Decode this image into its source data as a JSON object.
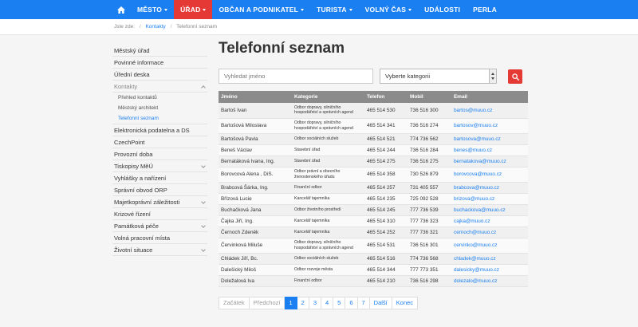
{
  "nav": {
    "home_icon": "home-icon",
    "items": [
      {
        "label": "MĚSTO",
        "dropdown": true
      },
      {
        "label": "ÚŘAD",
        "dropdown": true,
        "active": true
      },
      {
        "label": "OBČAN A PODNIKATEL",
        "dropdown": true
      },
      {
        "label": "TURISTA",
        "dropdown": true
      },
      {
        "label": "VOLNÝ ČAS",
        "dropdown": true
      },
      {
        "label": "UDÁLOSTI",
        "dropdown": false
      },
      {
        "label": "PERLA",
        "dropdown": false
      }
    ],
    "active_color": "#e53935",
    "bar_color": "#1a7ff0"
  },
  "breadcrumb": {
    "prefix": "Jste zde:",
    "items": [
      "Kontakty",
      "Telefonní seznam"
    ]
  },
  "sidebar": {
    "items": [
      {
        "label": "Městský úřad"
      },
      {
        "label": "Povinné informace"
      },
      {
        "label": "Úřední deska"
      },
      {
        "label": "Kontakty",
        "expanded": true,
        "chevron": "chevron-up-icon"
      },
      {
        "label": "Elektronická podatelna a DS"
      },
      {
        "label": "CzechPoint"
      },
      {
        "label": "Provozní doba"
      },
      {
        "label": "Tiskopisy MěÚ",
        "chevron": "chevron-down-icon"
      },
      {
        "label": "Vyhlášky a nařízení"
      },
      {
        "label": "Správní obvod ORP"
      },
      {
        "label": "Majetkoprávní záležitosti",
        "chevron": "chevron-down-icon"
      },
      {
        "label": "Krizové řízení"
      },
      {
        "label": "Památková péče",
        "chevron": "chevron-down-icon"
      },
      {
        "label": "Volná pracovní místa"
      },
      {
        "label": "Životní situace",
        "chevron": "chevron-down-icon"
      }
    ],
    "subitems": [
      {
        "label": "Přehled kontaktů"
      },
      {
        "label": "Městský architekt"
      },
      {
        "label": "Telefonní seznam",
        "current": true
      }
    ]
  },
  "main": {
    "title": "Telefonní seznam",
    "search_placeholder": "Vyhledat jméno",
    "category_select": "Vyberte kategorii",
    "search_button_icon": "search-icon"
  },
  "table": {
    "headers": [
      "Jméno",
      "Kategorie",
      "Telefon",
      "Mobil",
      "Email"
    ],
    "rows": [
      {
        "name": "Bartoš Ivan",
        "category": "Odbor dopravy, silničního hospodářství a správních agend",
        "phone": "465 514 530",
        "mobile": "736 516 300",
        "email": "bartos@muuo.cz"
      },
      {
        "name": "Bartošová Miloslava",
        "category": "Odbor dopravy, silničního hospodářství a správních agend",
        "phone": "465 514 341",
        "mobile": "736 516 274",
        "email": "bartosov@muuo.cz"
      },
      {
        "name": "Bartošová Pavla",
        "category": "Odbor sociálních služeb",
        "phone": "465 514 521",
        "mobile": "774 736 562",
        "email": "bartosova@muuo.cz"
      },
      {
        "name": "Beneš Václav",
        "category": "Stavební úřad",
        "phone": "465 514 244",
        "mobile": "736 516 284",
        "email": "benes@muuo.cz"
      },
      {
        "name": "Bernatáková Ivana, Ing.",
        "category": "Stavební úřad",
        "phone": "465 514 275",
        "mobile": "736 516 275",
        "email": "bernatakova@muuo.cz"
      },
      {
        "name": "Borovcová Alena , DiS.",
        "category": "Odbor právní a obecního živnostenského úřadu",
        "phone": "465 514 358",
        "mobile": "730 526 879",
        "email": "borovcova@muuo.cz"
      },
      {
        "name": "Brabcová Šárka, Ing.",
        "category": "Finanční odbor",
        "phone": "465 514 257",
        "mobile": "731 405 557",
        "email": "brabcova@muuo.cz"
      },
      {
        "name": "Břízová Lucie",
        "category": "Kancelář tajemníka",
        "phone": "465 514 235",
        "mobile": "725 092 528",
        "email": "brizova@muuo.cz"
      },
      {
        "name": "Buchačková Jana",
        "category": "Odbor životního prostředí",
        "phone": "465 514 245",
        "mobile": "777 736 539",
        "email": "buchackova@muuo.cz"
      },
      {
        "name": "Čajka Jiří, Ing.",
        "category": "Kancelář tajemníka",
        "phone": "465 514 310",
        "mobile": "777 736 323",
        "email": "cajka@muuo.cz"
      },
      {
        "name": "Černoch Zdeněk",
        "category": "Kancelář tajemníka",
        "phone": "465 514 252",
        "mobile": "777 736 321",
        "email": "cernoch@muuo.cz"
      },
      {
        "name": "Červinková Miluše",
        "category": "Odbor dopravy, silničního hospodářství a správních agend",
        "phone": "465 514 531",
        "mobile": "736 516 301",
        "email": "cervinko@muuo.cz"
      },
      {
        "name": "Chládek Jiří, Bc.",
        "category": "Odbor sociálních služeb",
        "phone": "465 514 516",
        "mobile": "774 736 568",
        "email": "chladek@muuo.cz"
      },
      {
        "name": "Dalešický Miloš",
        "category": "Odbor rozvoje města",
        "phone": "465 514 344",
        "mobile": "777 773 351",
        "email": "dalesicky@muuo.cz"
      },
      {
        "name": "Doležalová Iva",
        "category": "Finanční odbor",
        "phone": "465 514 210",
        "mobile": "736 516 298",
        "email": "dolezalo@muuo.cz"
      }
    ]
  },
  "pagination": {
    "first": "Začátek",
    "prev": "Předchozí",
    "pages": [
      "1",
      "2",
      "3",
      "4",
      "5",
      "6",
      "7"
    ],
    "current": "1",
    "next": "Další",
    "last": "Konec"
  }
}
